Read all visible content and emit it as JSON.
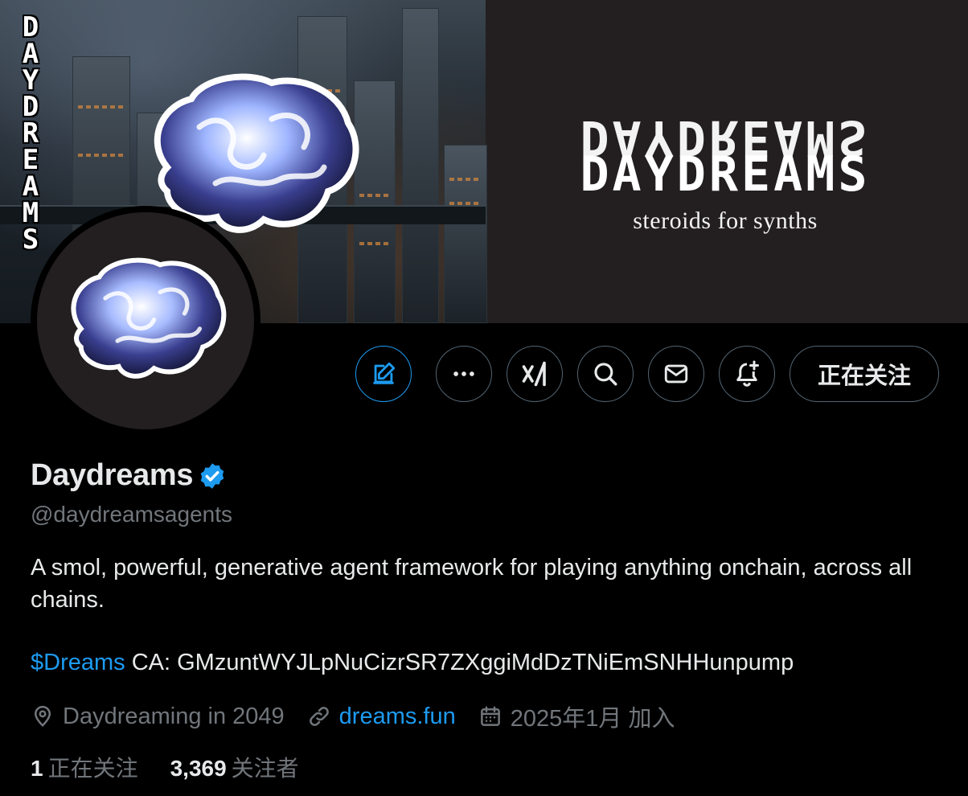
{
  "banner": {
    "vertical_text": [
      "D",
      "A",
      "Y",
      "D",
      "R",
      "E",
      "A",
      "M",
      "S"
    ],
    "logo_top": "DAYDREAMS",
    "logo_bottom": "DAYDREAMS",
    "tagline": "steroids for synths"
  },
  "actions": {
    "edit_icon": "edit-icon",
    "more_icon": "more-icon",
    "grok_icon": "grok-icon",
    "search_icon": "search-icon",
    "message_icon": "message-icon",
    "notify_icon": "notification-add-icon",
    "follow_label": "正在关注"
  },
  "profile": {
    "display_name": "Daydreams",
    "handle": "@daydreamsagents",
    "bio_line1": "A smol, powerful, generative agent framework for playing anything onchain, across all chains.",
    "bio_cashtag": "$Dreams",
    "bio_ca": " CA: GMzuntWYJLpNuCizrSR7ZXggiMdDzTNiEmSNHHunpump",
    "location": "Daydreaming in 2049",
    "website": "dreams.fun",
    "joined": "2025年1月 加入"
  },
  "stats": {
    "following_count": "1",
    "following_label": "正在关注",
    "followers_count": "3,369",
    "followers_label": "关注者"
  },
  "colors": {
    "accent": "#1d9bf0",
    "text": "#e7e9ea",
    "muted": "#71767b",
    "border": "#536471",
    "banner_bg": "#231f20"
  }
}
